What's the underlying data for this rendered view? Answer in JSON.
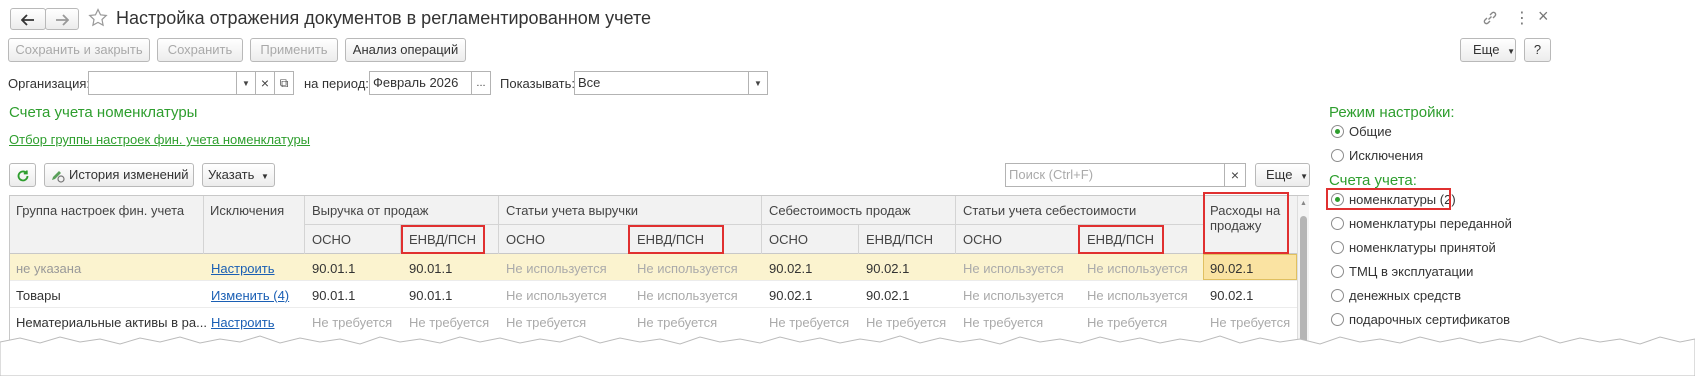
{
  "window": {
    "title": "Настройка отражения документов в регламентированном учете"
  },
  "toolbar": {
    "save_close": "Сохранить и закрыть",
    "save": "Сохранить",
    "apply": "Применить",
    "analysis": "Анализ операций",
    "more": "Еще",
    "help": "?"
  },
  "filters": {
    "org_label": "Организация:",
    "org_value": "",
    "period_label": "на период:",
    "period_value": "Февраль 2026",
    "ellipsis": "...",
    "show_label": "Показывать:",
    "show_value": "Все"
  },
  "section": {
    "title": "Счета учета номенклатуры",
    "filter_link": "Отбор группы настроек фин. учета номенклатуры"
  },
  "table_toolbar": {
    "history": "История изменений",
    "specify": "Указать",
    "search_placeholder": "Поиск (Ctrl+F)",
    "more": "Еще"
  },
  "table": {
    "headers": {
      "group": "Группа настроек фин. учета",
      "exceptions": "Исключения",
      "revenue": "Выручка от продаж",
      "revenue_items": "Статьи учета выручки",
      "cost": "Себестоимость продаж",
      "cost_items": "Статьи учета себестоимости",
      "expenses": "Расходы на продажу",
      "osno": "ОСНО",
      "envd": "ЕНВД/ПСН"
    },
    "rows": [
      {
        "group": "не указана",
        "exceptions": "Настроить",
        "rev_osno": "90.01.1",
        "rev_envd": "90.01.1",
        "ri_osno": "Не используется",
        "ri_envd": "Не используется",
        "cost_osno": "90.02.1",
        "cost_envd": "90.02.1",
        "ci_osno": "Не используется",
        "ci_envd": "Не используется",
        "expenses": "90.02.1"
      },
      {
        "group": "Товары",
        "exceptions": "Изменить (4)",
        "rev_osno": "90.01.1",
        "rev_envd": "90.01.1",
        "ri_osno": "Не используется",
        "ri_envd": "Не используется",
        "cost_osno": "90.02.1",
        "cost_envd": "90.02.1",
        "ci_osno": "Не используется",
        "ci_envd": "Не используется",
        "expenses": "90.02.1"
      },
      {
        "group": "Нематериальные активы в ра...",
        "exceptions": "Настроить",
        "rev_osno": "Не требуется",
        "rev_envd": "Не требуется",
        "ri_osno": "Не требуется",
        "ri_envd": "Не требуется",
        "cost_osno": "Не требуется",
        "cost_envd": "Не требуется",
        "ci_osno": "Не требуется",
        "ci_envd": "Не требуется",
        "expenses": "Не требуется"
      }
    ]
  },
  "right_panel": {
    "mode_title": "Режим настройки:",
    "modes": [
      "Общие",
      "Исключения"
    ],
    "accounts_title": "Счета учета:",
    "accounts": [
      "номенклатуры (2)",
      "номенклатуры переданной",
      "номенклатуры принятой",
      "ТМЦ в эксплуатации",
      "денежных средств",
      "подарочных сертификатов"
    ]
  },
  "colors": {
    "accent_green": "#2e9e2e",
    "highlight": "#e03030",
    "selected_row": "#fbf3cf"
  }
}
